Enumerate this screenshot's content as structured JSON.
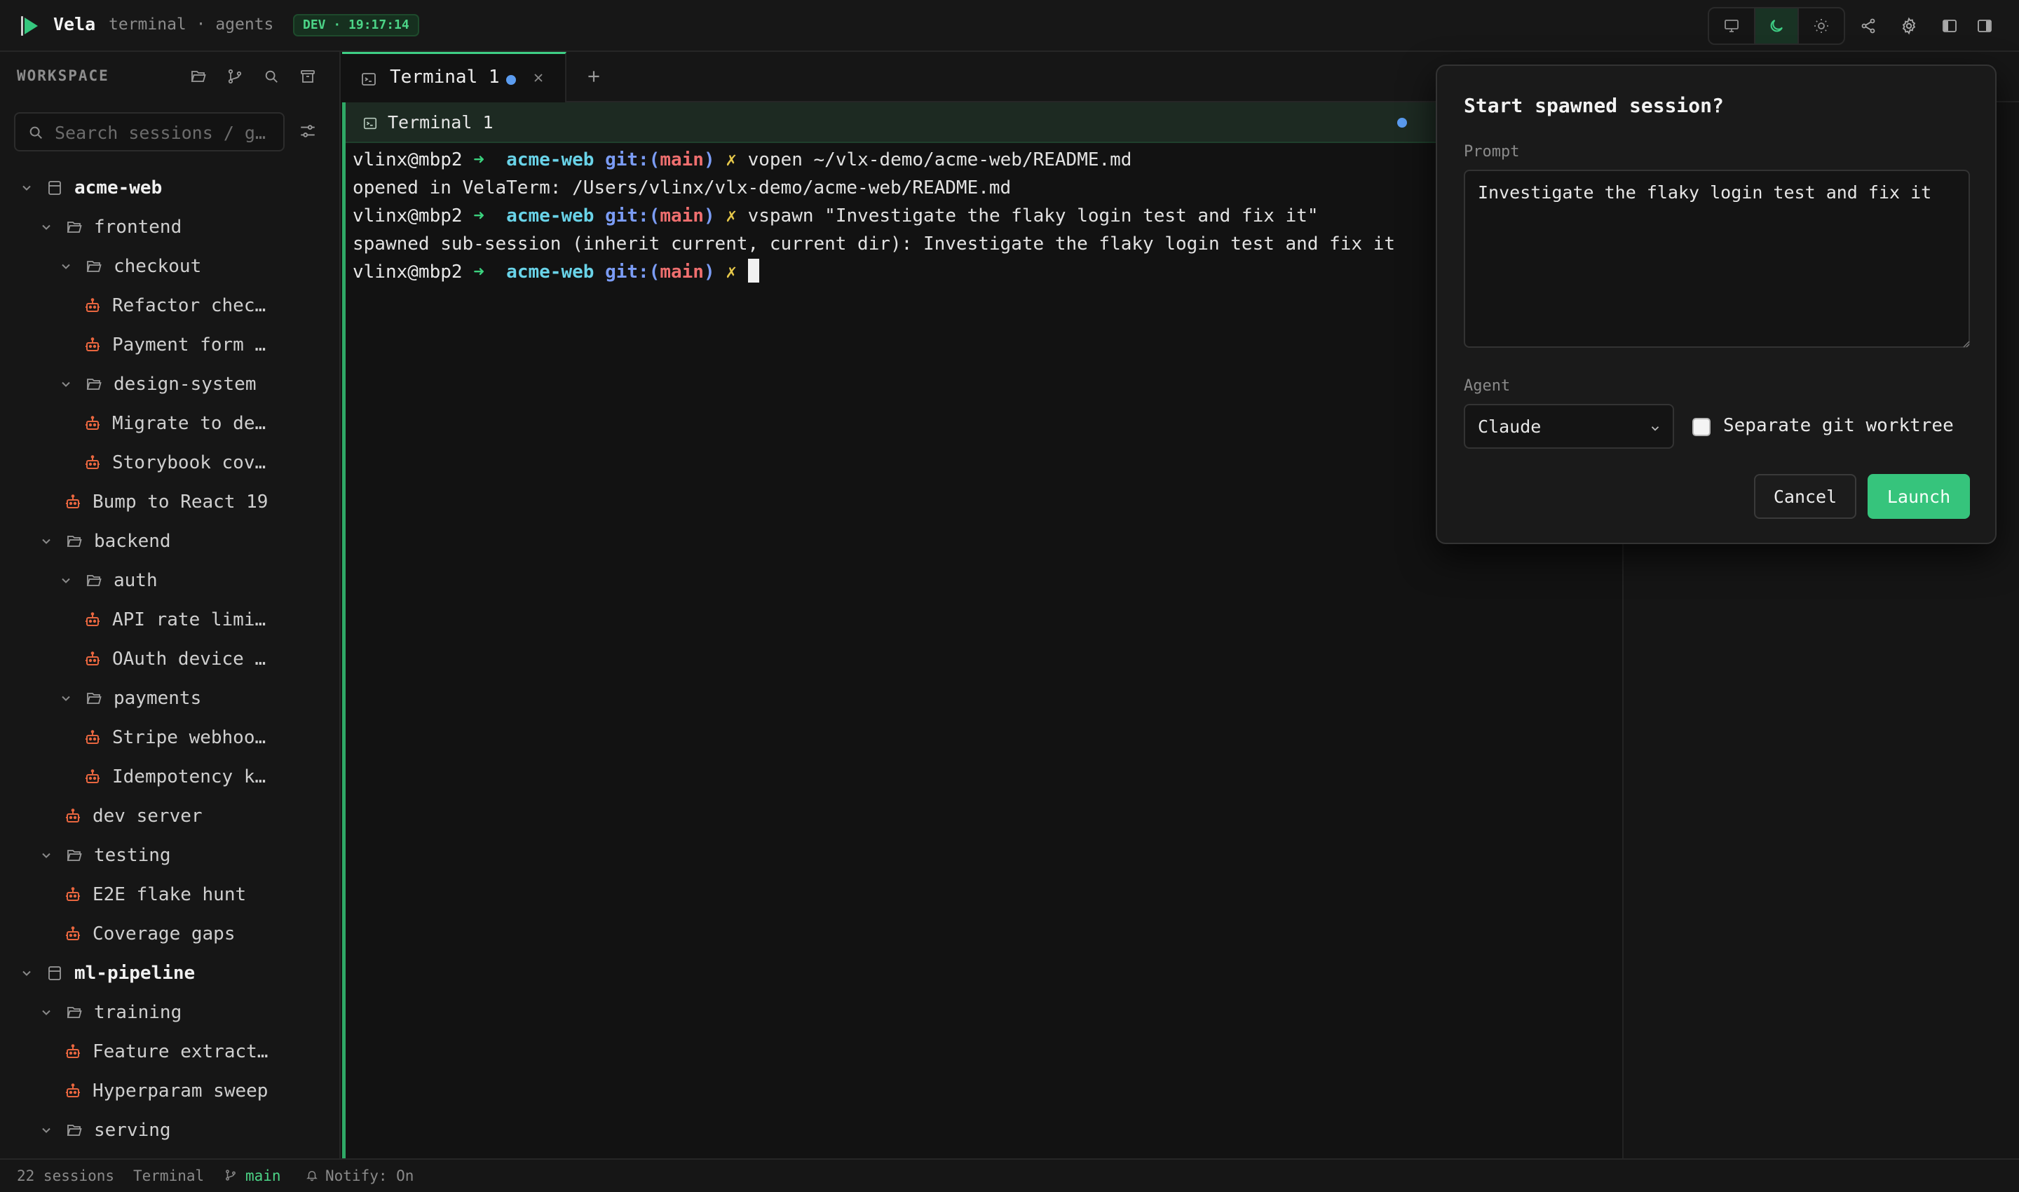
{
  "app": {
    "name": "Vela",
    "subtitle": "terminal · agents",
    "env_badge": "DEV · 19:17:14"
  },
  "toolbar": {
    "modes": [
      "monitor-icon",
      "moon-icon",
      "sun-icon"
    ],
    "active_mode": "moon-icon",
    "actions": [
      "share-icon",
      "gear-icon",
      "left-panel-icon",
      "right-panel-icon"
    ]
  },
  "sidebar": {
    "header": "WORKSPACE",
    "header_icons": [
      "folder-open-icon",
      "git-branch-icon",
      "search-icon",
      "archive-icon"
    ],
    "search_placeholder": "Search sessions / g…",
    "tree": [
      {
        "label": "acme-web",
        "kind": "project"
      },
      {
        "label": "frontend",
        "kind": "folder"
      },
      {
        "label": "checkout",
        "kind": "folder"
      },
      {
        "label": "Refactor chec…",
        "kind": "session"
      },
      {
        "label": "Payment form …",
        "kind": "session"
      },
      {
        "label": "design-system",
        "kind": "folder"
      },
      {
        "label": "Migrate to de…",
        "kind": "session"
      },
      {
        "label": "Storybook cov…",
        "kind": "session"
      },
      {
        "label": "Bump to React 19",
        "kind": "session"
      },
      {
        "label": "backend",
        "kind": "folder"
      },
      {
        "label": "auth",
        "kind": "folder"
      },
      {
        "label": "API rate limi…",
        "kind": "session"
      },
      {
        "label": "OAuth device …",
        "kind": "session"
      },
      {
        "label": "payments",
        "kind": "folder"
      },
      {
        "label": "Stripe webhoo…",
        "kind": "session"
      },
      {
        "label": "Idempotency k…",
        "kind": "session"
      },
      {
        "label": "dev server",
        "kind": "session"
      },
      {
        "label": "testing",
        "kind": "folder"
      },
      {
        "label": "E2E flake hunt",
        "kind": "session"
      },
      {
        "label": "Coverage gaps",
        "kind": "session"
      },
      {
        "label": "ml-pipeline",
        "kind": "project"
      },
      {
        "label": "training",
        "kind": "folder"
      },
      {
        "label": "Feature extract…",
        "kind": "session"
      },
      {
        "label": "Hyperparam sweep",
        "kind": "session"
      },
      {
        "label": "serving",
        "kind": "folder"
      }
    ]
  },
  "tabs": [
    {
      "label": "Terminal 1",
      "active": true,
      "has_unread": true
    }
  ],
  "terminal": {
    "title": "Terminal 1",
    "lines": [
      {
        "prompt": true,
        "user": "vlinx@mbp2",
        "arrow": "➜",
        "dir": "acme-web",
        "git": "git:(",
        "branch": "main",
        "git_close": ")",
        "mark": "✗",
        "cmd": "vopen ~/vlx-demo/acme-web/README.md"
      },
      {
        "prompt": false,
        "text": "opened in VelaTerm: /Users/vlinx/vlx-demo/acme-web/README.md"
      },
      {
        "prompt": true,
        "user": "vlinx@mbp2",
        "arrow": "➜",
        "dir": "acme-web",
        "git": "git:(",
        "branch": "main",
        "git_close": ")",
        "mark": "✗",
        "cmd": "vspawn \"Investigate the flaky login test and fix it\""
      },
      {
        "prompt": false,
        "text": "spawned sub-session (inherit current, current dir): Investigate the flaky login test and fix it"
      },
      {
        "prompt": true,
        "user": "vlinx@mbp2",
        "arrow": "➜",
        "dir": "acme-web",
        "git": "git:(",
        "branch": "main",
        "git_close": ")",
        "mark": "✗",
        "cmd": "",
        "cursor": true
      }
    ]
  },
  "modal": {
    "title": "Start spawned session?",
    "prompt_label": "Prompt",
    "prompt_value": "Investigate the flaky login test and fix it",
    "agent_label": "Agent",
    "agent_value": "Claude",
    "worktree_label": "Separate git worktree",
    "worktree_checked": false,
    "cancel_label": "Cancel",
    "launch_label": "Launch"
  },
  "statusbar": {
    "sessions": "22 sessions",
    "mode": "Terminal",
    "branch": "main",
    "notify": "Notify: On"
  },
  "colors": {
    "accent": "#36c47c",
    "session_icon": "#e8663f",
    "dot_blue": "#5b9cf0"
  }
}
